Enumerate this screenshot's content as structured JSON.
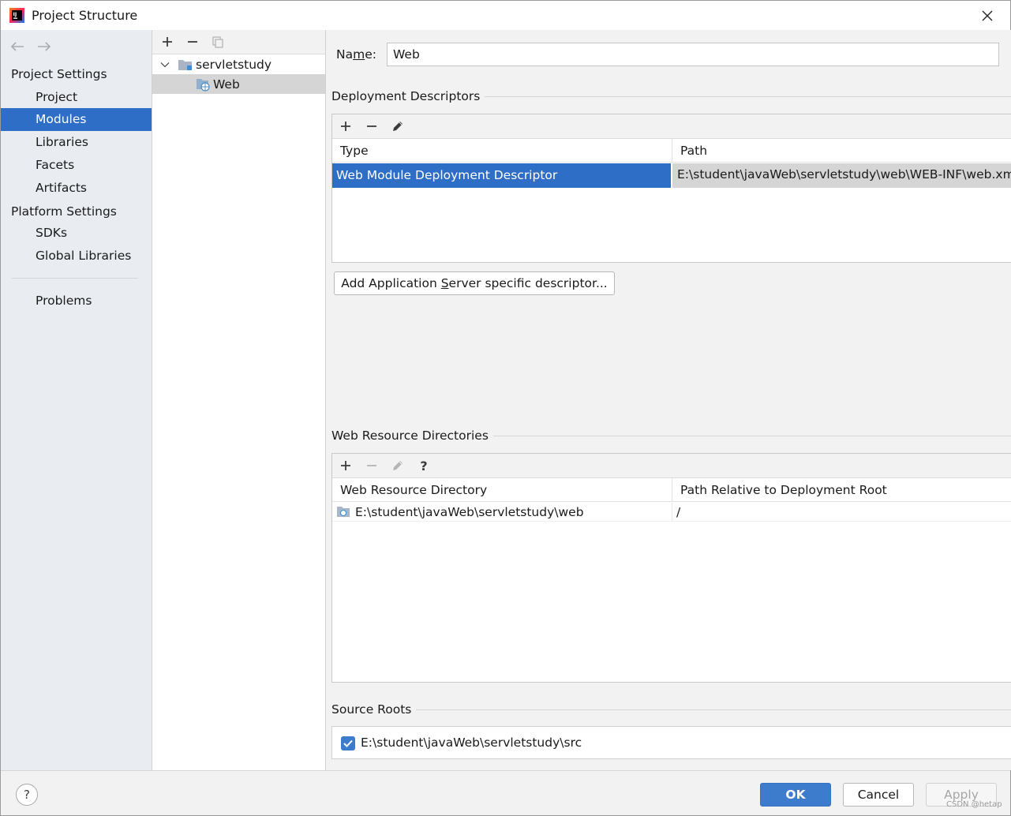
{
  "window": {
    "title": "Project Structure",
    "close_label": "✕"
  },
  "sidebar": {
    "back_label": "←",
    "forward_label": "→",
    "project_settings_header": "Project Settings",
    "project_items": [
      {
        "label": "Project"
      },
      {
        "label": "Modules",
        "selected": true
      },
      {
        "label": "Libraries"
      },
      {
        "label": "Facets"
      },
      {
        "label": "Artifacts"
      }
    ],
    "platform_settings_header": "Platform Settings",
    "platform_items": [
      {
        "label": "SDKs"
      },
      {
        "label": "Global Libraries"
      }
    ],
    "problems_label": "Problems"
  },
  "tree": {
    "toolbar": {
      "add": "+",
      "remove": "−"
    },
    "nodes": [
      {
        "label": "servletstudy",
        "expanded": true
      },
      {
        "label": "Web",
        "selected": true
      }
    ]
  },
  "facet": {
    "name_label_pre": "Na",
    "name_label_mnemonic": "m",
    "name_label_post": "e:",
    "name_value": "Web",
    "deployment_descriptors": {
      "title": "Deployment Descriptors",
      "toolbar": {
        "add": "+",
        "remove": "−"
      },
      "columns": [
        "Type",
        "Path"
      ],
      "rows": [
        {
          "type": "Web Module Deployment Descriptor",
          "path": "E:\\student\\javaWeb\\servletstudy\\web\\WEB-INF\\web.xml",
          "selected": true
        }
      ],
      "add_server_button_pre": "Add Application ",
      "add_server_button_mnemonic": "S",
      "add_server_button_post": "erver specific descriptor..."
    },
    "web_resource_directories": {
      "title": "Web Resource Directories",
      "toolbar": {
        "add": "+",
        "remove": "−",
        "help": "?"
      },
      "columns": [
        "Web Resource Directory",
        "Path Relative to Deployment Root"
      ],
      "rows": [
        {
          "directory": "E:\\student\\javaWeb\\servletstudy\\web",
          "relative_path": "/"
        }
      ]
    },
    "source_roots": {
      "title": "Source Roots",
      "items": [
        {
          "path": "E:\\student\\javaWeb\\servletstudy\\src",
          "checked": true
        }
      ]
    }
  },
  "footer": {
    "help_label": "?",
    "ok_label": "OK",
    "cancel_label": "Cancel",
    "apply_label": "Apply"
  },
  "watermark": "CSDN @hetap",
  "colors": {
    "selection_blue": "#2f6ec6",
    "sidebar_bg": "#e9edf2",
    "primary_button": "#3d7ccc"
  }
}
